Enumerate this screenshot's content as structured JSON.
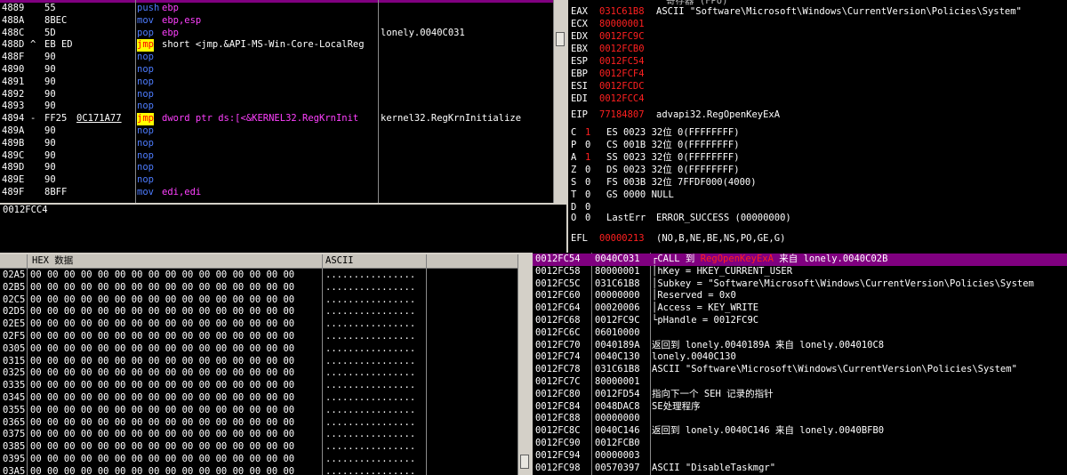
{
  "disasm": {
    "rows": [
      {
        "addr": "4889",
        "mark": "",
        "bytes": "55",
        "arg": "",
        "mn": "push",
        "mc": "blue",
        "op": "ebp",
        "comment": ""
      },
      {
        "addr": "488A",
        "mark": "",
        "bytes": "8BEC",
        "arg": "",
        "mn": "mov",
        "mc": "blue",
        "op": "ebp,esp",
        "comment": ""
      },
      {
        "addr": "488C",
        "mark": "",
        "bytes": "5D",
        "arg": "",
        "mn": "pop",
        "mc": "blue",
        "op": "ebp",
        "comment": "lonely.0040C031"
      },
      {
        "addr": "488D",
        "mark": "^",
        "bytes": "EB ED",
        "arg": "",
        "mn": "jmp",
        "mc": "yel",
        "op": "short <jmp.&API-MS-Win-Core-LocalReg",
        "comment": ""
      },
      {
        "addr": "488F",
        "mark": "",
        "bytes": "90",
        "arg": "",
        "mn": "nop",
        "mc": "blue",
        "op": "",
        "comment": ""
      },
      {
        "addr": "4890",
        "mark": "",
        "bytes": "90",
        "arg": "",
        "mn": "nop",
        "mc": "blue",
        "op": "",
        "comment": ""
      },
      {
        "addr": "4891",
        "mark": "",
        "bytes": "90",
        "arg": "",
        "mn": "nop",
        "mc": "blue",
        "op": "",
        "comment": ""
      },
      {
        "addr": "4892",
        "mark": "",
        "bytes": "90",
        "arg": "",
        "mn": "nop",
        "mc": "blue",
        "op": "",
        "comment": ""
      },
      {
        "addr": "4893",
        "mark": "",
        "bytes": "90",
        "arg": "",
        "mn": "nop",
        "mc": "blue",
        "op": "",
        "comment": ""
      },
      {
        "addr": "4894",
        "mark": "-",
        "bytes": "FF25",
        "arg": "0C171A77",
        "mn": "jmp",
        "mc": "yel",
        "op": "dword ptr ds:[<&KERNEL32.RegKrnInit",
        "comment": "kernel32.RegKrnInitialize"
      },
      {
        "addr": "489A",
        "mark": "",
        "bytes": "90",
        "arg": "",
        "mn": "nop",
        "mc": "blue",
        "op": "",
        "comment": ""
      },
      {
        "addr": "489B",
        "mark": "",
        "bytes": "90",
        "arg": "",
        "mn": "nop",
        "mc": "blue",
        "op": "",
        "comment": ""
      },
      {
        "addr": "489C",
        "mark": "",
        "bytes": "90",
        "arg": "",
        "mn": "nop",
        "mc": "blue",
        "op": "",
        "comment": ""
      },
      {
        "addr": "489D",
        "mark": "",
        "bytes": "90",
        "arg": "",
        "mn": "nop",
        "mc": "blue",
        "op": "",
        "comment": ""
      },
      {
        "addr": "489E",
        "mark": "",
        "bytes": "90",
        "arg": "",
        "mn": "nop",
        "mc": "blue",
        "op": "",
        "comment": ""
      },
      {
        "addr": "489F",
        "mark": "",
        "bytes": "8BFF",
        "arg": "",
        "mn": "mov",
        "mc": "blue",
        "op": "edi,edi",
        "comment": ""
      }
    ],
    "info_line": "0012FCC4"
  },
  "registers": {
    "title_fragment": "寄存器 (FPU)",
    "gp": [
      {
        "name": "EAX",
        "value": "031C61B8",
        "info": "ASCII \"Software\\Microsoft\\Windows\\CurrentVersion\\Policies\\System\""
      },
      {
        "name": "ECX",
        "value": "80000001",
        "info": ""
      },
      {
        "name": "EDX",
        "value": "0012FC9C",
        "info": ""
      },
      {
        "name": "EBX",
        "value": "0012FCB0",
        "info": ""
      },
      {
        "name": "ESP",
        "value": "0012FC54",
        "info": ""
      },
      {
        "name": "EBP",
        "value": "0012FCF4",
        "info": ""
      },
      {
        "name": "ESI",
        "value": "0012FCDC",
        "info": ""
      },
      {
        "name": "EDI",
        "value": "0012FCC4",
        "info": ""
      }
    ],
    "eip": {
      "name": "EIP",
      "value": "77184807",
      "info": "advapi32.RegOpenKeyExA"
    },
    "flags": [
      {
        "f": "C",
        "v": "1",
        "seg": "ES 0023 32位 0(FFFFFFFF)",
        "vc": "red"
      },
      {
        "f": "P",
        "v": "0",
        "seg": "CS 001B 32位 0(FFFFFFFF)",
        "vc": ""
      },
      {
        "f": "A",
        "v": "1",
        "seg": "SS 0023 32位 0(FFFFFFFF)",
        "vc": "red"
      },
      {
        "f": "Z",
        "v": "0",
        "seg": "DS 0023 32位 0(FFFFFFFF)",
        "vc": ""
      },
      {
        "f": "S",
        "v": "0",
        "seg": "FS 003B 32位 7FFDF000(4000)",
        "vc": ""
      },
      {
        "f": "T",
        "v": "0",
        "seg": "GS 0000 NULL",
        "vc": ""
      },
      {
        "f": "D",
        "v": "0",
        "seg": "",
        "vc": ""
      }
    ],
    "lasterr": {
      "f": "O",
      "v": "0",
      "label": "LastErr",
      "value": "ERROR_SUCCESS (00000000)"
    },
    "efl": {
      "name": "EFL",
      "value": "00000213",
      "info": "(NO,B,NE,BE,NS,PO,GE,G)"
    }
  },
  "dump": {
    "header_hex": "HEX 数据",
    "header_ascii": "ASCII",
    "addresses": [
      "02A5",
      "02B5",
      "02C5",
      "02D5",
      "02E5",
      "02F5",
      "0305",
      "0315",
      "0325",
      "0335",
      "0345",
      "0355",
      "0365",
      "0375",
      "0385",
      "0395",
      "03A5"
    ],
    "hex_row": "00 00 00 00 00 00 00 00 00 00 00 00 00 00 00 00",
    "ascii_row": "................"
  },
  "stack": {
    "rows": [
      {
        "addr": "0012FC54",
        "val": "0040C031",
        "sel": true,
        "pre": "┌CALL 到 ",
        "hl": "RegOpenKeyExA",
        "post": " 来自 lonely.0040C02B"
      },
      {
        "addr": "0012FC58",
        "val": "80000001",
        "sel": false,
        "pre": "│hKey = HKEY_CURRENT_USER",
        "hl": "",
        "post": ""
      },
      {
        "addr": "0012FC5C",
        "val": "031C61B8",
        "sel": false,
        "pre": "│Subkey = \"Software\\Microsoft\\Windows\\CurrentVersion\\Policies\\System",
        "hl": "",
        "post": ""
      },
      {
        "addr": "0012FC60",
        "val": "00000000",
        "sel": false,
        "pre": "│Reserved = 0x0",
        "hl": "",
        "post": ""
      },
      {
        "addr": "0012FC64",
        "val": "00020006",
        "sel": false,
        "pre": "│Access = KEY_WRITE",
        "hl": "",
        "post": ""
      },
      {
        "addr": "0012FC68",
        "val": "0012FC9C",
        "sel": false,
        "pre": "└pHandle = 0012FC9C",
        "hl": "",
        "post": ""
      },
      {
        "addr": "0012FC6C",
        "val": "06010000",
        "sel": false,
        "pre": "",
        "hl": "",
        "post": ""
      },
      {
        "addr": "0012FC70",
        "val": "0040189A",
        "sel": false,
        "pre": "返回到 lonely.0040189A 来自 lonely.004010C8",
        "hl": "",
        "post": ""
      },
      {
        "addr": "0012FC74",
        "val": "0040C130",
        "sel": false,
        "pre": "lonely.0040C130",
        "hl": "",
        "post": ""
      },
      {
        "addr": "0012FC78",
        "val": "031C61B8",
        "sel": false,
        "pre": "ASCII \"Software\\Microsoft\\Windows\\CurrentVersion\\Policies\\System\"",
        "hl": "",
        "post": ""
      },
      {
        "addr": "0012FC7C",
        "val": "80000001",
        "sel": false,
        "pre": "",
        "hl": "",
        "post": ""
      },
      {
        "addr": "0012FC80",
        "val": "0012FD54",
        "sel": false,
        "pre": "指向下一个 SEH 记录的指针",
        "hl": "",
        "post": ""
      },
      {
        "addr": "0012FC84",
        "val": "0048DAC8",
        "sel": false,
        "pre": "SE处理程序",
        "hl": "",
        "post": ""
      },
      {
        "addr": "0012FC88",
        "val": "00000000",
        "sel": false,
        "pre": "",
        "hl": "",
        "post": ""
      },
      {
        "addr": "0012FC8C",
        "val": "0040C146",
        "sel": false,
        "pre": "返回到 lonely.0040C146 来自 lonely.0040BFB0",
        "hl": "",
        "post": ""
      },
      {
        "addr": "0012FC90",
        "val": "0012FCB0",
        "sel": false,
        "pre": "",
        "hl": "",
        "post": ""
      },
      {
        "addr": "0012FC94",
        "val": "00000003",
        "sel": false,
        "pre": "",
        "hl": "",
        "post": ""
      },
      {
        "addr": "0012FC98",
        "val": "00570397",
        "sel": false,
        "pre": "ASCII \"DisableTaskmgr\"",
        "hl": "",
        "post": ""
      }
    ]
  },
  "colors": {
    "selection": "#800080",
    "highlight": "#ff2020",
    "jump": "#ffff00",
    "keyword": "#4d7cff",
    "operand": "#ff40ff"
  }
}
